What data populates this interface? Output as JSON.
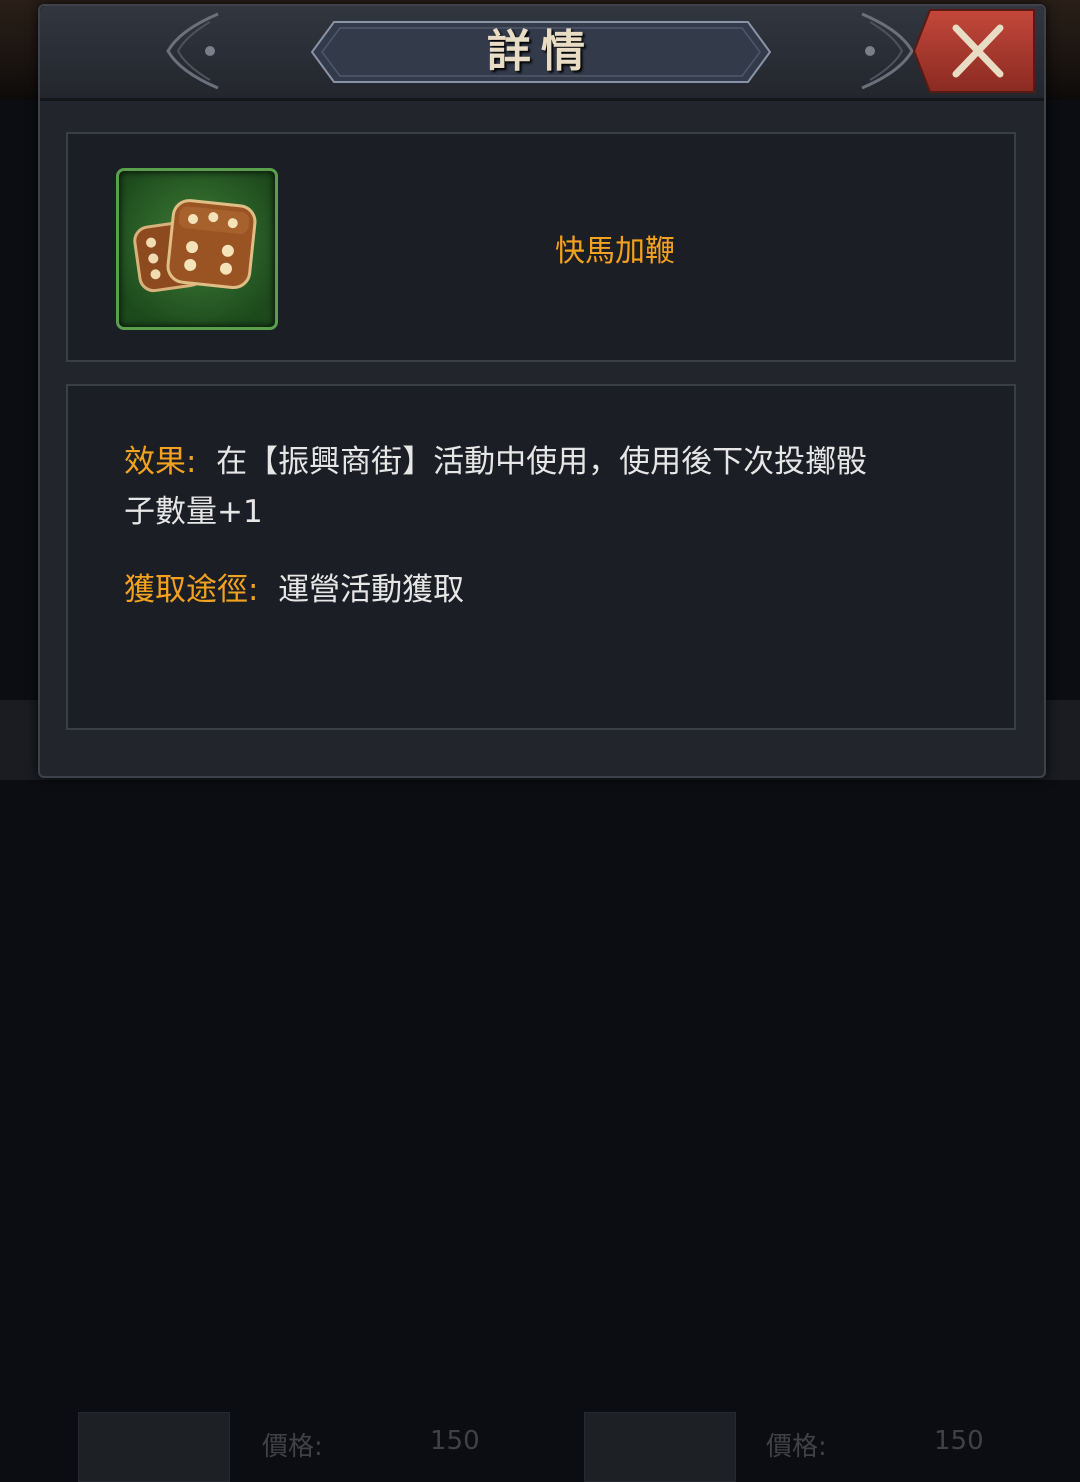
{
  "dialog": {
    "title": "詳情",
    "close_icon": "close-x-icon"
  },
  "item": {
    "icon": "dice-icon",
    "name": "快馬加鞭"
  },
  "description": {
    "effect_label": "效果:",
    "effect_text_line1": "在【振興商街】活動中使用，使用後下次投擲骰",
    "effect_text_line2": "子數量+1",
    "source_label": "獲取途徑:",
    "source_text": "運營活動獲取"
  },
  "background_shop": {
    "price_label_1": "價格:",
    "price_value_1": "150",
    "price_label_2": "價格:",
    "price_value_2": "150"
  },
  "colors": {
    "accent_orange": "#f2a21e",
    "close_red": "#b83a2e",
    "frame_green": "#5aa04c"
  }
}
